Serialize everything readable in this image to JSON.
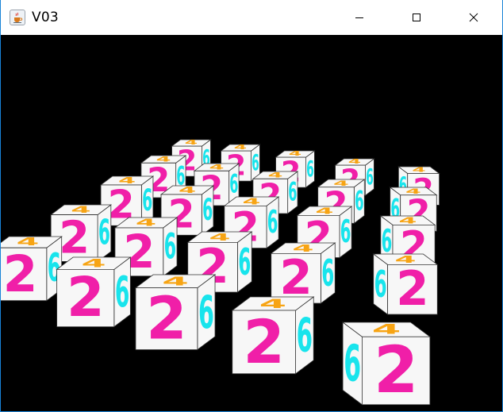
{
  "window": {
    "title": "V03",
    "icon": "java-coffee-cup-icon",
    "controls": [
      "minimize-icon",
      "maximize-icon",
      "close-icon"
    ]
  },
  "scene": {
    "description_numbers": {
      "top": "4",
      "front": "2",
      "side": "6"
    },
    "colors": {
      "background": "#000000",
      "face": "#f7f7f7",
      "top_digit": "#f7a413",
      "front_digit": "#f01fa8",
      "side_digit": "#18e4ec"
    }
  }
}
